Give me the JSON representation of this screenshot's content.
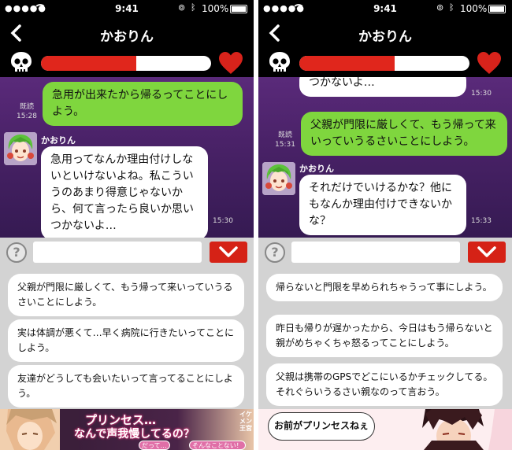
{
  "status": {
    "time": "9:41",
    "battery": "100%"
  },
  "header": {
    "title": "かおりん",
    "back_label": "<"
  },
  "icons": {
    "left": "skull-icon",
    "right": "heart-icon"
  },
  "colors": {
    "gauge_fill": "#e0261c",
    "my_bubble": "#7fd63e",
    "accent_button": "#d52216"
  },
  "screens": [
    {
      "gauge_level": 0.56,
      "messages": [
        {
          "from": "me",
          "text": "急用が出来たから帰るってことにしよう。",
          "read": "既読",
          "time": "15:28"
        },
        {
          "from": "other",
          "sender": "かおりん",
          "text": "急用ってなんか理由付けしないといけないよね。私こういうのあまり得意じゃないから、何て言ったら良いか思いつかないよ…",
          "time": "15:30"
        }
      ],
      "input": {
        "value": ""
      },
      "choices": [
        "父親が門限に厳しくて、もう帰って来いっていうるさいことにしよう。",
        "実は体調が悪くて…早く病院に行きたいってことにしよう。",
        "友達がどうしても会いたいって言ってることにしよう。"
      ],
      "banner": {
        "line1": "プリンセス…",
        "line2": "なんで声我慢してるの？",
        "button1": "だって…",
        "button2": "そんなことない！",
        "side": "イケメン王宮"
      }
    },
    {
      "gauge_level": 0.56,
      "messages": [
        {
          "from": "other",
          "text": "つかないよ…",
          "time": "15:30"
        },
        {
          "from": "me",
          "text": "父親が門限に厳しくて、もう帰って来いっていうるさいことにしよう。",
          "read": "既読",
          "time": "15:31"
        },
        {
          "from": "other",
          "sender": "かおりん",
          "text": "それだけでいけるかな？他にもなんか理由付けできないかな？",
          "time": "15:33"
        }
      ],
      "input": {
        "value": ""
      },
      "choices": [
        "帰らないと門限を早められちゃうって事にしよう。",
        "昨日も帰りが遅かったから、今日はもう帰らないと親がめちゃくちゃ怒るってことにしよう。",
        "父親は携帯のGPSでどこにいるかチェックしてる。それぐらいうるさい親なのって言おう。"
      ],
      "banner": {
        "speech": "お前がプリンセスねぇ"
      }
    }
  ]
}
